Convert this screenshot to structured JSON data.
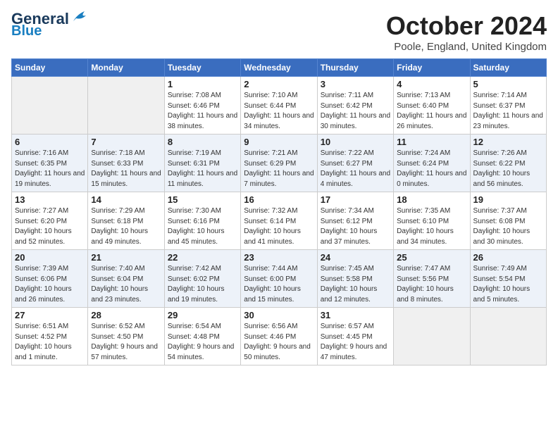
{
  "header": {
    "logo_line1": "General",
    "logo_line2": "Blue",
    "month": "October 2024",
    "location": "Poole, England, United Kingdom"
  },
  "days_of_week": [
    "Sunday",
    "Monday",
    "Tuesday",
    "Wednesday",
    "Thursday",
    "Friday",
    "Saturday"
  ],
  "weeks": [
    [
      {
        "day": "",
        "empty": true
      },
      {
        "day": "",
        "empty": true
      },
      {
        "day": "1",
        "sunrise": "7:08 AM",
        "sunset": "6:46 PM",
        "daylight": "11 hours and 38 minutes."
      },
      {
        "day": "2",
        "sunrise": "7:10 AM",
        "sunset": "6:44 PM",
        "daylight": "11 hours and 34 minutes."
      },
      {
        "day": "3",
        "sunrise": "7:11 AM",
        "sunset": "6:42 PM",
        "daylight": "11 hours and 30 minutes."
      },
      {
        "day": "4",
        "sunrise": "7:13 AM",
        "sunset": "6:40 PM",
        "daylight": "11 hours and 26 minutes."
      },
      {
        "day": "5",
        "sunrise": "7:14 AM",
        "sunset": "6:37 PM",
        "daylight": "11 hours and 23 minutes."
      }
    ],
    [
      {
        "day": "6",
        "sunrise": "7:16 AM",
        "sunset": "6:35 PM",
        "daylight": "11 hours and 19 minutes."
      },
      {
        "day": "7",
        "sunrise": "7:18 AM",
        "sunset": "6:33 PM",
        "daylight": "11 hours and 15 minutes."
      },
      {
        "day": "8",
        "sunrise": "7:19 AM",
        "sunset": "6:31 PM",
        "daylight": "11 hours and 11 minutes."
      },
      {
        "day": "9",
        "sunrise": "7:21 AM",
        "sunset": "6:29 PM",
        "daylight": "11 hours and 7 minutes."
      },
      {
        "day": "10",
        "sunrise": "7:22 AM",
        "sunset": "6:27 PM",
        "daylight": "11 hours and 4 minutes."
      },
      {
        "day": "11",
        "sunrise": "7:24 AM",
        "sunset": "6:24 PM",
        "daylight": "11 hours and 0 minutes."
      },
      {
        "day": "12",
        "sunrise": "7:26 AM",
        "sunset": "6:22 PM",
        "daylight": "10 hours and 56 minutes."
      }
    ],
    [
      {
        "day": "13",
        "sunrise": "7:27 AM",
        "sunset": "6:20 PM",
        "daylight": "10 hours and 52 minutes."
      },
      {
        "day": "14",
        "sunrise": "7:29 AM",
        "sunset": "6:18 PM",
        "daylight": "10 hours and 49 minutes."
      },
      {
        "day": "15",
        "sunrise": "7:30 AM",
        "sunset": "6:16 PM",
        "daylight": "10 hours and 45 minutes."
      },
      {
        "day": "16",
        "sunrise": "7:32 AM",
        "sunset": "6:14 PM",
        "daylight": "10 hours and 41 minutes."
      },
      {
        "day": "17",
        "sunrise": "7:34 AM",
        "sunset": "6:12 PM",
        "daylight": "10 hours and 37 minutes."
      },
      {
        "day": "18",
        "sunrise": "7:35 AM",
        "sunset": "6:10 PM",
        "daylight": "10 hours and 34 minutes."
      },
      {
        "day": "19",
        "sunrise": "7:37 AM",
        "sunset": "6:08 PM",
        "daylight": "10 hours and 30 minutes."
      }
    ],
    [
      {
        "day": "20",
        "sunrise": "7:39 AM",
        "sunset": "6:06 PM",
        "daylight": "10 hours and 26 minutes."
      },
      {
        "day": "21",
        "sunrise": "7:40 AM",
        "sunset": "6:04 PM",
        "daylight": "10 hours and 23 minutes."
      },
      {
        "day": "22",
        "sunrise": "7:42 AM",
        "sunset": "6:02 PM",
        "daylight": "10 hours and 19 minutes."
      },
      {
        "day": "23",
        "sunrise": "7:44 AM",
        "sunset": "6:00 PM",
        "daylight": "10 hours and 15 minutes."
      },
      {
        "day": "24",
        "sunrise": "7:45 AM",
        "sunset": "5:58 PM",
        "daylight": "10 hours and 12 minutes."
      },
      {
        "day": "25",
        "sunrise": "7:47 AM",
        "sunset": "5:56 PM",
        "daylight": "10 hours and 8 minutes."
      },
      {
        "day": "26",
        "sunrise": "7:49 AM",
        "sunset": "5:54 PM",
        "daylight": "10 hours and 5 minutes."
      }
    ],
    [
      {
        "day": "27",
        "sunrise": "6:51 AM",
        "sunset": "4:52 PM",
        "daylight": "10 hours and 1 minute."
      },
      {
        "day": "28",
        "sunrise": "6:52 AM",
        "sunset": "4:50 PM",
        "daylight": "9 hours and 57 minutes."
      },
      {
        "day": "29",
        "sunrise": "6:54 AM",
        "sunset": "4:48 PM",
        "daylight": "9 hours and 54 minutes."
      },
      {
        "day": "30",
        "sunrise": "6:56 AM",
        "sunset": "4:46 PM",
        "daylight": "9 hours and 50 minutes."
      },
      {
        "day": "31",
        "sunrise": "6:57 AM",
        "sunset": "4:45 PM",
        "daylight": "9 hours and 47 minutes."
      },
      {
        "day": "",
        "empty": true
      },
      {
        "day": "",
        "empty": true
      }
    ]
  ]
}
